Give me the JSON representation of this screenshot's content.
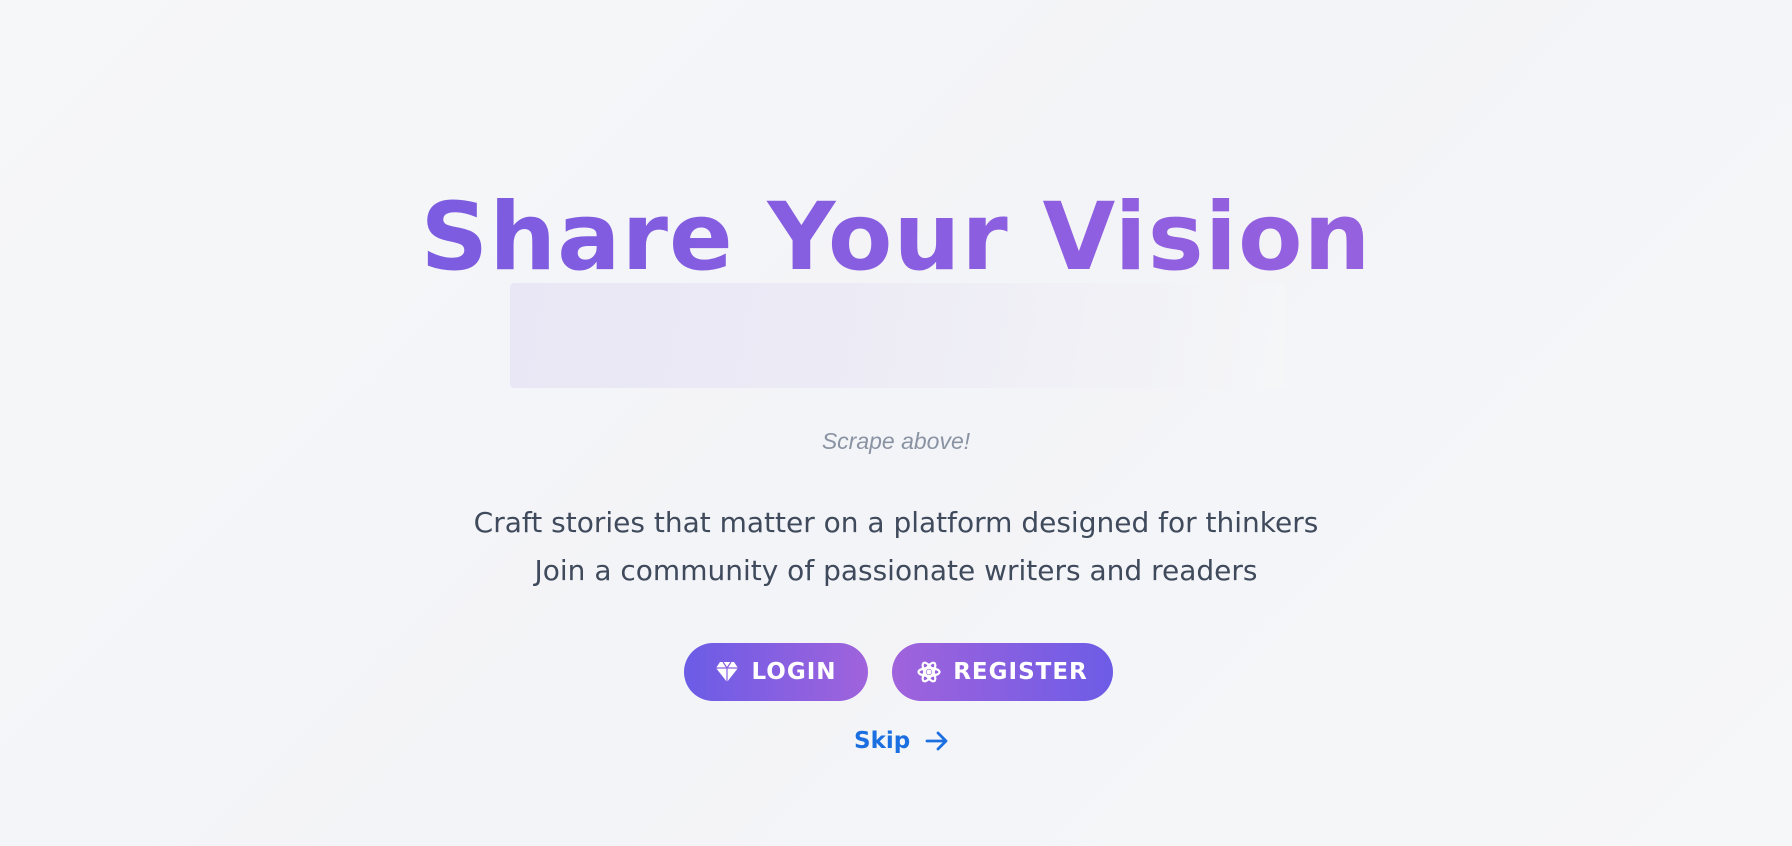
{
  "hero": {
    "title": "Share Your Vision",
    "scratch_hint": "Scrape above!",
    "tagline_line1": "Craft stories that matter on a platform designed for thinkers",
    "tagline_line2": "Join a community of passionate writers and readers"
  },
  "actions": {
    "login_label": "LOGIN",
    "login_icon": "diamond-icon",
    "register_label": "REGISTER",
    "register_icon": "atom-icon",
    "skip_label": "Skip",
    "skip_icon": "arrow-right-icon"
  },
  "colors": {
    "title_gradient_start": "#7059e0",
    "title_gradient_end": "#a064dc",
    "button_gradient_purple": "#6b5ce6",
    "button_gradient_violet": "#a063dc",
    "skip_link": "#1c6fe0",
    "tagline_text": "#3f4a5c",
    "hint_text": "#8a93a3",
    "background": "#f5f6f8"
  }
}
